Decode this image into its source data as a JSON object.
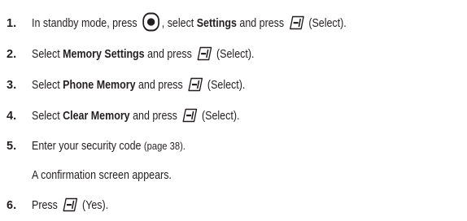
{
  "steps": [
    {
      "number": "1.",
      "p1": "In standby mode, press",
      "p2": ", select",
      "bold1": "Settings",
      "p3": "and press",
      "p4": "(Select).",
      "icons": [
        "menu-ok-key-icon",
        "left-softkey-icon"
      ]
    },
    {
      "number": "2.",
      "p1": "Select",
      "bold1": "Memory Settings",
      "p2": "and press",
      "p3": "(Select).",
      "icons": [
        "left-softkey-icon"
      ]
    },
    {
      "number": "3.",
      "p1": "Select",
      "bold1": "Phone Memory",
      "p2": "and press",
      "p3": "(Select).",
      "icons": [
        "left-softkey-icon"
      ]
    },
    {
      "number": "4.",
      "p1": "Select",
      "bold1": "Clear Memory",
      "p2": "and press",
      "p3": "(Select).",
      "icons": [
        "left-softkey-icon"
      ]
    },
    {
      "number": "5.",
      "p1": "Enter your security code",
      "p2": "(page 38).",
      "note": "A confirmation screen appears."
    },
    {
      "number": "6.",
      "p1": "Press",
      "p2": "(Yes).",
      "icons": [
        "left-softkey-icon"
      ]
    }
  ]
}
